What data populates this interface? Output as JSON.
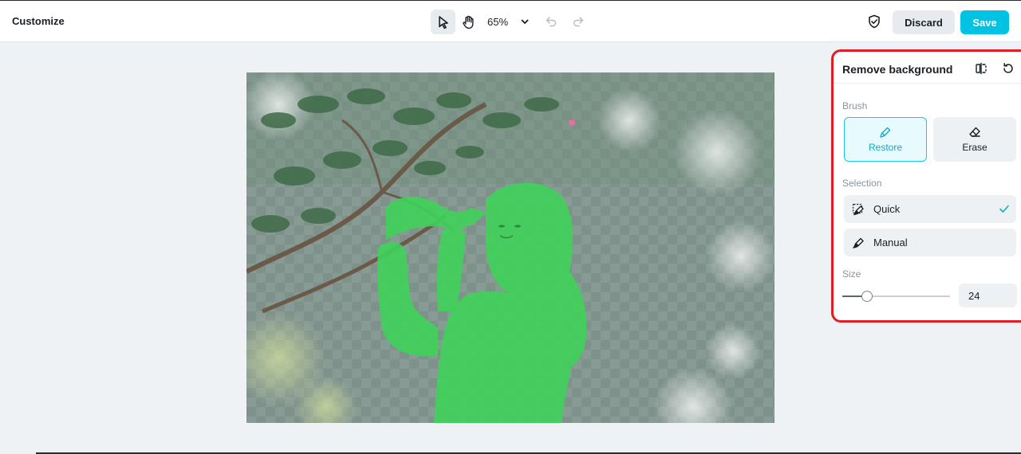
{
  "header": {
    "title": "Customize",
    "tools": [
      {
        "name": "select",
        "icon": "pointer-icon",
        "active": true
      },
      {
        "name": "pan",
        "icon": "hand-icon",
        "active": false
      }
    ],
    "zoom": "65%",
    "discard_label": "Discard",
    "save_label": "Save"
  },
  "panel": {
    "title": "Remove background",
    "brush_label": "Brush",
    "brush_options": [
      {
        "label": "Restore",
        "icon": "restore-brush-icon",
        "selected": true
      },
      {
        "label": "Erase",
        "icon": "eraser-icon",
        "selected": false
      }
    ],
    "selection_label": "Selection",
    "selection_options": [
      {
        "label": "Quick",
        "icon": "quick-brush-icon",
        "selected": true
      },
      {
        "label": "Manual",
        "icon": "manual-brush-icon",
        "selected": false
      }
    ],
    "size_label": "Size",
    "size_value": "24",
    "size_fraction": 0.23
  },
  "colors": {
    "accent": "#00c3e3",
    "highlight_border": "#e11d26",
    "mask_green": "#3fd25a"
  }
}
